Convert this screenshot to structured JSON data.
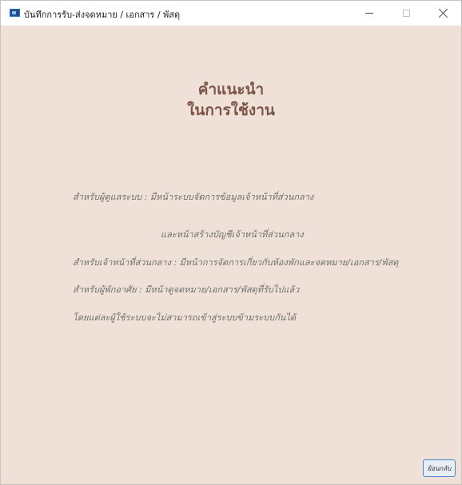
{
  "window": {
    "title": "บันทึกการรับ-ส่งจดหมาย / เอกสาร / พัสดุ",
    "icon": "app-window-icon",
    "controls": {
      "minimize": "minimize-icon",
      "maximize": "maximize-icon",
      "close": "close-icon"
    }
  },
  "heading": {
    "line1": "คำแนะนำ",
    "line2": "ในการใช้งาน"
  },
  "instructions": [
    "สำหรับผู้ดูแลระบบ : มีหน้าระบบจัดการข้อมูลเจ้าหน้าที่ส่วนกลาง",
    "และหน้าสร้างบัญชีเจ้าหน้าที่ส่วนกลาง",
    "สำหรับเจ้าหน้าที่ส่วนกลาง : มีหน้าการจัดการเกี่ยวกับห้องพักและจดหมาย/เอกสาร/พัสดุ",
    "สำหรับผู้พักอาศัย : มีหน้าดูจดหมาย/เอกสาร/พัสดุที่รับไปแล้ว",
    "โดยแต่ละผู้ใช้ระบบจะไม่สามารถเข้าสู่ระบบข้ามระบบกันได้"
  ],
  "buttons": {
    "back_label": "ย้อนกลับ"
  },
  "colors": {
    "background": "#efe1d7",
    "heading": "#7a5547",
    "text": "#6f6f6f",
    "button_border": "#4a86c8"
  }
}
